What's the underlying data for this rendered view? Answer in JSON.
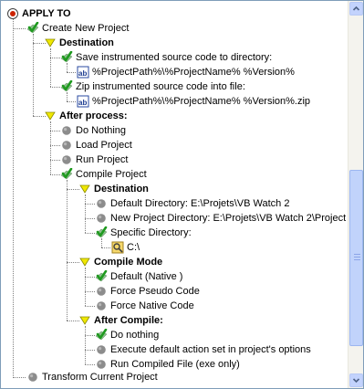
{
  "tree": {
    "root": {
      "label": "APPLY TO",
      "icon": "apply-to-icon"
    },
    "create_new_project": {
      "label": "Create New Project",
      "icon": "green-check-icon"
    },
    "destination": {
      "label": "Destination",
      "icon": "yellow-triangle-icon"
    },
    "save_source": {
      "label": "Save instrumented source code to directory:",
      "icon": "green-check-icon"
    },
    "save_path": {
      "label": "%ProjectPath%\\%ProjectName% %Version%",
      "icon": "text-field-icon"
    },
    "zip_source": {
      "label": "Zip instrumented source code into file:",
      "icon": "green-check-icon"
    },
    "zip_path": {
      "label": "%ProjectPath%\\%ProjectName% %Version%.zip",
      "icon": "text-field-icon"
    },
    "after_process": {
      "label": "After process:",
      "icon": "yellow-triangle-icon"
    },
    "do_nothing": {
      "label": "Do Nothing",
      "icon": "gray-dot-icon"
    },
    "load_project": {
      "label": "Load Project",
      "icon": "gray-dot-icon"
    },
    "run_project": {
      "label": "Run Project",
      "icon": "gray-dot-icon"
    },
    "compile_project": {
      "label": "Compile Project",
      "icon": "green-check-icon"
    },
    "compile_destination": {
      "label": "Destination",
      "icon": "yellow-triangle-icon"
    },
    "default_directory": {
      "label": "Default Directory: E:\\Projets\\VB Watch 2",
      "icon": "gray-dot-icon"
    },
    "new_project_directory": {
      "label": "New Project Directory: E:\\Projets\\VB Watch 2\\Project",
      "icon": "gray-dot-icon"
    },
    "specific_directory": {
      "label": "Specific Directory:",
      "icon": "green-check-icon"
    },
    "specific_path": {
      "label": "C:\\",
      "icon": "folder-search-icon"
    },
    "compile_mode": {
      "label": "Compile Mode",
      "icon": "yellow-triangle-icon"
    },
    "default_native": {
      "label": "Default (Native )",
      "icon": "green-check-icon"
    },
    "force_pseudo": {
      "label": "Force Pseudo Code",
      "icon": "gray-dot-icon"
    },
    "force_native": {
      "label": "Force Native Code",
      "icon": "gray-dot-icon"
    },
    "after_compile": {
      "label": "After Compile:",
      "icon": "yellow-triangle-icon"
    },
    "ac_do_nothing": {
      "label": "Do nothing",
      "icon": "green-check-icon"
    },
    "ac_execute_default": {
      "label": "Execute default action set in project's options",
      "icon": "gray-dot-icon"
    },
    "ac_run_compiled": {
      "label": "Run Compiled File (exe only)",
      "icon": "gray-dot-icon"
    },
    "transform_current": {
      "label": "Transform Current Project",
      "icon": "gray-dot-icon"
    }
  },
  "colors": {
    "check": "#2e9e2e",
    "triangle": "#e8e000",
    "dot": "#8a8a8a",
    "root": "#cc2200"
  }
}
